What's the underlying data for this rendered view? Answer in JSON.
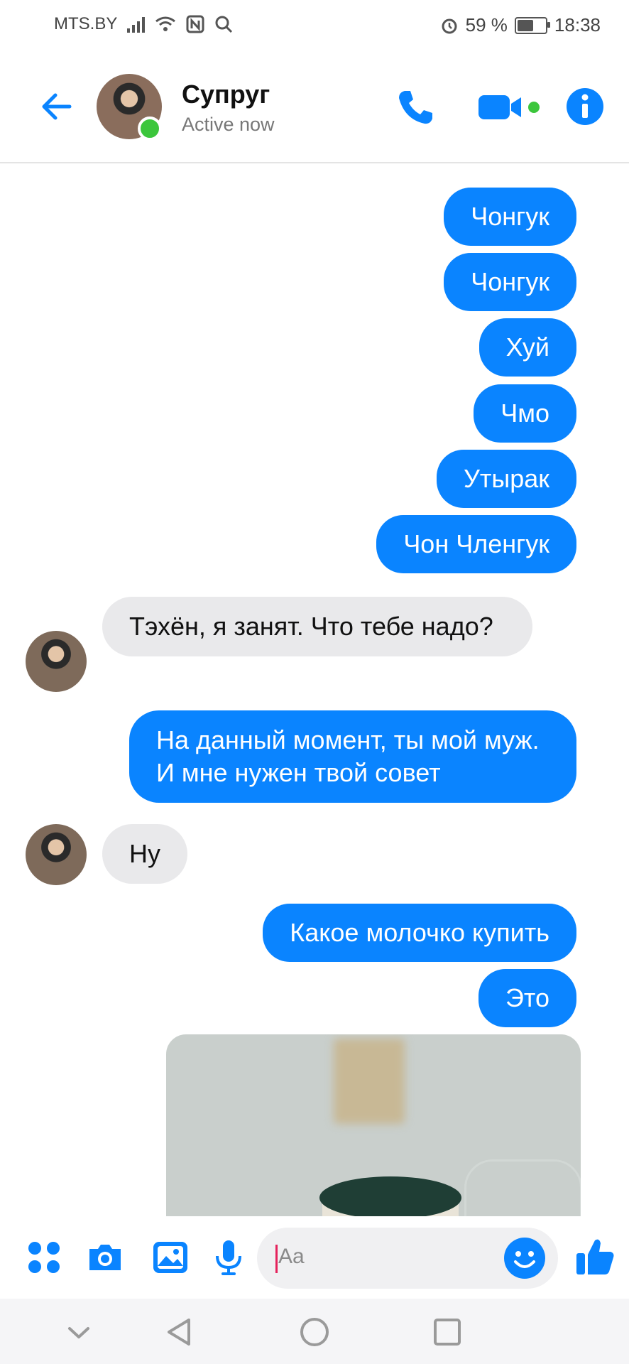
{
  "status_bar": {
    "carrier": "MTS.BY",
    "battery": "59 %",
    "battery_level": 0.59,
    "time": "18:38"
  },
  "header": {
    "name": "Супруг",
    "status": "Active now"
  },
  "messages": [
    {
      "dir": "out",
      "text": "Чонгук"
    },
    {
      "dir": "out",
      "text": "Чонгук"
    },
    {
      "dir": "out",
      "text": "Хуй"
    },
    {
      "dir": "out",
      "text": "Чмо"
    },
    {
      "dir": "out",
      "text": "Утырак"
    },
    {
      "dir": "out",
      "text": "Чон Членгук"
    },
    {
      "dir": "in",
      "text": "Тэхён, я занят. Что тебе надо?"
    },
    {
      "dir": "out",
      "text": "На данный момент, ты мой муж. И мне нужен твой совет"
    },
    {
      "dir": "in",
      "text": "Ну"
    },
    {
      "dir": "out",
      "text": "Какое молочко купить"
    },
    {
      "dir": "out",
      "text": "Это"
    }
  ],
  "composer": {
    "placeholder": "Aa"
  },
  "colors": {
    "accent": "#0a84ff",
    "online": "#3cc63c",
    "incoming_bubble": "#e9e9eb"
  }
}
